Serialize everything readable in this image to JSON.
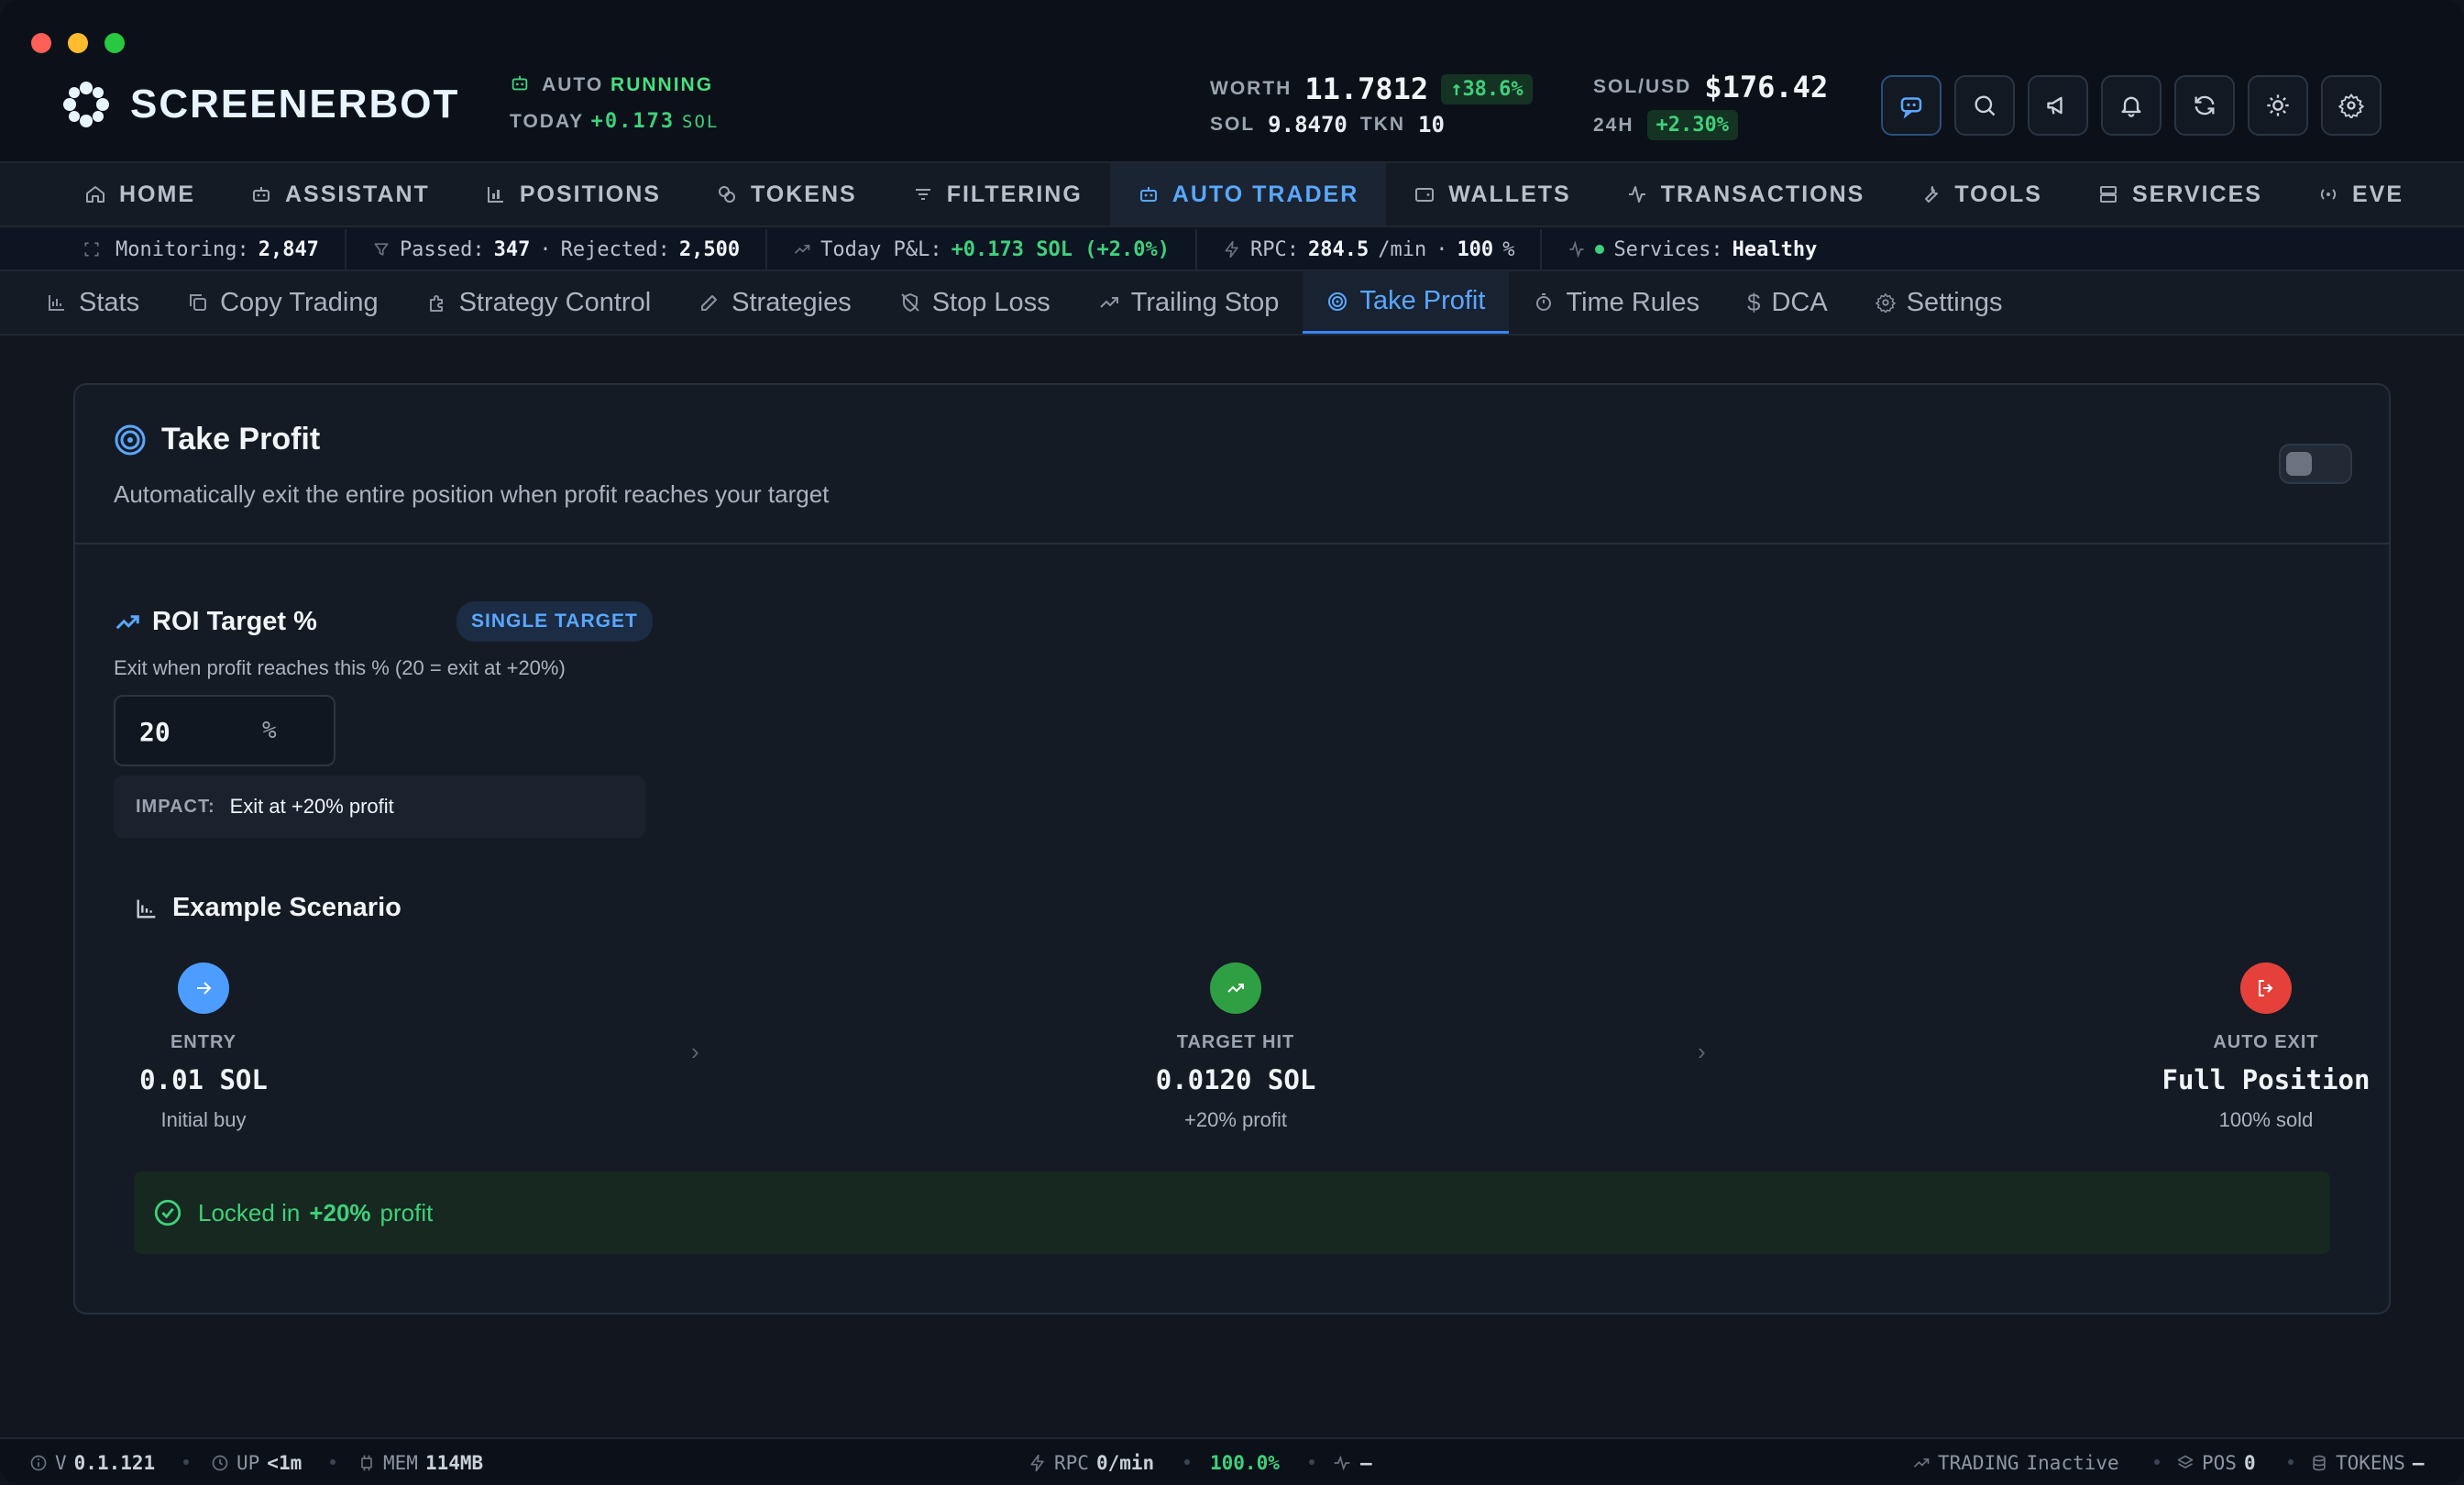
{
  "brand": {
    "name": "SCREENERBOT"
  },
  "status": {
    "auto_label": "AUTO",
    "auto_state": "RUNNING",
    "today_label": "TODAY",
    "today_value": "+0.173",
    "today_unit": "SOL"
  },
  "worth": {
    "label": "WORTH",
    "value": "11.7812",
    "change": "38.6%",
    "sol_label": "SOL",
    "sol_value": "9.8470",
    "tkn_label": "TKN",
    "tkn_value": "10"
  },
  "solusd": {
    "label": "SOL/USD",
    "price": "$176.42",
    "h24_label": "24H",
    "h24_change": "+2.30%"
  },
  "header_buttons": [
    "assistant-icon",
    "search-icon",
    "megaphone-icon",
    "bell-icon",
    "refresh-icon",
    "sun-icon",
    "gear-icon"
  ],
  "nav": {
    "items": [
      {
        "label": "HOME",
        "icon": "home-icon"
      },
      {
        "label": "ASSISTANT",
        "icon": "bot-icon"
      },
      {
        "label": "POSITIONS",
        "icon": "chart-icon"
      },
      {
        "label": "TOKENS",
        "icon": "coins-icon"
      },
      {
        "label": "FILTERING",
        "icon": "filter-icon"
      },
      {
        "label": "AUTO TRADER",
        "icon": "bot-icon",
        "active": true
      },
      {
        "label": "WALLETS",
        "icon": "wallet-icon"
      },
      {
        "label": "TRANSACTIONS",
        "icon": "activity-icon"
      },
      {
        "label": "TOOLS",
        "icon": "wrench-icon"
      },
      {
        "label": "SERVICES",
        "icon": "server-icon"
      },
      {
        "label": "EVE",
        "icon": "radio-icon"
      }
    ]
  },
  "strip": {
    "monitoring_label": "Monitoring:",
    "monitoring_value": "2,847",
    "passed_label": "Passed:",
    "passed_value": "347",
    "sep": "·",
    "rejected_label": "Rejected:",
    "rejected_value": "2,500",
    "pnl_label": "Today P&L:",
    "pnl_value": "+0.173 SOL (+2.0%)",
    "rpc_label": "RPC:",
    "rpc_value": "284.5",
    "rpc_unit": "/min",
    "rpc_pct": "100",
    "rpc_pct_unit": "%",
    "services_label": "Services:",
    "services_value": "Healthy"
  },
  "subnav": {
    "items": [
      {
        "label": "Stats",
        "icon": "bar-chart-icon"
      },
      {
        "label": "Copy Trading",
        "icon": "copy-icon"
      },
      {
        "label": "Strategy Control",
        "icon": "puzzle-icon"
      },
      {
        "label": "Strategies",
        "icon": "edit-icon"
      },
      {
        "label": "Stop Loss",
        "icon": "shield-off-icon"
      },
      {
        "label": "Trailing Stop",
        "icon": "trending-up-icon"
      },
      {
        "label": "Take Profit",
        "icon": "target-icon",
        "active": true
      },
      {
        "label": "Time Rules",
        "icon": "timer-icon"
      },
      {
        "label": "DCA",
        "icon": "dollar-icon"
      },
      {
        "label": "Settings",
        "icon": "gear-icon"
      }
    ]
  },
  "card": {
    "title": "Take Profit",
    "description": "Automatically exit the entire position when profit reaches your target",
    "enabled": false
  },
  "roi": {
    "title": "ROI Target %",
    "badge": "SINGLE TARGET",
    "description": "Exit when profit reaches this % (20 = exit at +20%)",
    "value": "20",
    "unit": "%",
    "impact_label": "IMPACT:",
    "impact_value": "Exit at +20% profit"
  },
  "example": {
    "title": "Example Scenario",
    "steps": [
      {
        "label": "ENTRY",
        "value": "0.01 SOL",
        "sub": "Initial buy",
        "color": "#4c9dff"
      },
      {
        "label": "TARGET HIT",
        "value": "0.0120 SOL",
        "sub": "+20% profit",
        "color": "#2ea043"
      },
      {
        "label": "AUTO EXIT",
        "value": "Full Position",
        "sub": "100% sold",
        "color": "#e5413a"
      }
    ],
    "locked_prefix": "Locked in",
    "locked_value": "+20%",
    "locked_suffix": "profit"
  },
  "footer": {
    "version_label": "V",
    "version": "0.1.121",
    "uptime_label": "UP",
    "uptime": "<1m",
    "mem_label": "MEM",
    "mem": "114MB",
    "rpc_label": "RPC",
    "rpc": "0/min",
    "rpc_pct": "100.0%",
    "pulse_value": "–",
    "trading_label": "TRADING",
    "trading": "Inactive",
    "pos_label": "POS",
    "pos": "0",
    "tokens_label": "TOKENS",
    "tokens": "–"
  },
  "colors": {
    "accent": "#5aa7ff",
    "positive": "#3fd07b",
    "negative": "#e5413a",
    "background": "#11161f"
  }
}
